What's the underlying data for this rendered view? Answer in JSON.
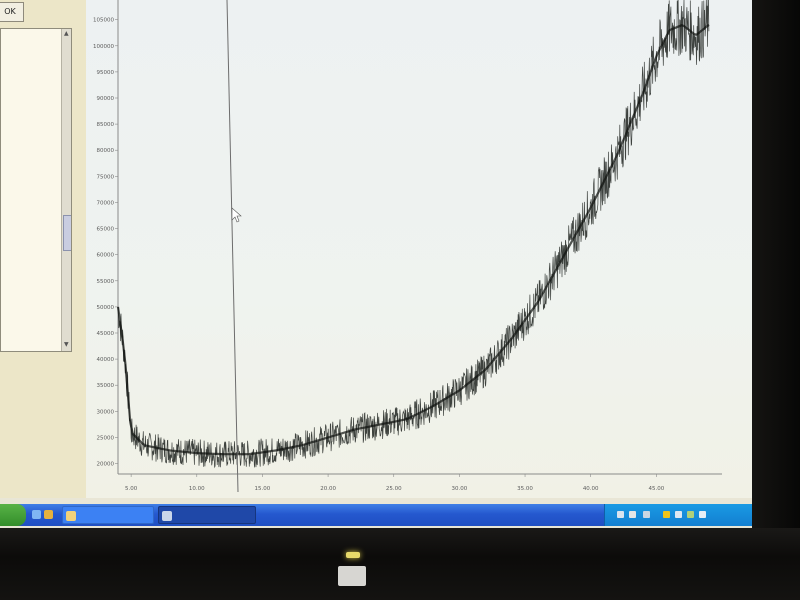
{
  "left_panel": {
    "ok_button_label": "OK",
    "list_items": [
      {
        "text": "",
        "selected": false
      },
      {
        "text": "",
        "selected": false
      },
      {
        "text": "",
        "selected": false
      },
      {
        "text": "",
        "selected": false
      },
      {
        "text": "",
        "selected": false
      },
      {
        "text": "",
        "selected": false
      },
      {
        "text": "",
        "selected": false
      },
      {
        "text": "",
        "selected": false
      },
      {
        "text": "",
        "selected": false
      },
      {
        "text": "",
        "selected": false
      },
      {
        "text": "",
        "selected": false
      },
      {
        "text": "",
        "selected": false
      },
      {
        "text": "",
        "selected": false
      },
      {
        "text": "",
        "selected": false
      },
      {
        "text": "",
        "selected": false
      },
      {
        "text": "",
        "selected": false
      },
      {
        "text": "",
        "selected": false
      },
      {
        "text": "",
        "selected": false
      },
      {
        "text": "",
        "selected": false
      },
      {
        "text": "",
        "selected": false
      },
      {
        "text": "",
        "selected": false
      },
      {
        "text": "",
        "selected": false
      },
      {
        "text": "",
        "selected": false
      },
      {
        "text": "",
        "selected": false
      },
      {
        "text": "",
        "selected": false
      },
      {
        "text": "",
        "selected": true
      }
    ]
  },
  "chart": {
    "x_unit_label": "",
    "x_ticks": [
      "5.00",
      "10.00",
      "15.00",
      "20.00",
      "25.00",
      "30.00",
      "35.00",
      "40.00",
      "45.00"
    ],
    "y_ticks": [
      "20000",
      "25000",
      "30000",
      "35000",
      "40000",
      "45000",
      "50000",
      "55000",
      "60000",
      "65000",
      "70000",
      "75000",
      "80000",
      "85000",
      "90000",
      "95000",
      "100000",
      "105000"
    ],
    "line_color": "#1f2320"
  },
  "chart_data": {
    "type": "line",
    "title": "",
    "xlabel": "",
    "ylabel": "",
    "xlim": [
      4.0,
      50.0
    ],
    "ylim": [
      18000,
      108000
    ],
    "grid": false,
    "series": [
      {
        "x": [
          4.0,
          4.5,
          5.0,
          6.0,
          8.0,
          10.0,
          12.0,
          14.0,
          16.0,
          18.0,
          20.0,
          22.0,
          24.0,
          26.0,
          28.0,
          30.0,
          32.0,
          34.0,
          36.0,
          38.0,
          40.0,
          42.0,
          44.0,
          45.0,
          46.0,
          47.0,
          48.0,
          49.0
        ],
        "y": [
          50000,
          41000,
          26000,
          23500,
          22500,
          22000,
          21800,
          21800,
          22500,
          23500,
          25000,
          26500,
          27500,
          28500,
          31000,
          34000,
          38000,
          44000,
          51000,
          60000,
          69000,
          79000,
          91000,
          98000,
          103000,
          104000,
          102000,
          104000
        ]
      }
    ]
  },
  "taskbar": {
    "start_label": "",
    "task_items": [
      {
        "label": "",
        "active": false
      },
      {
        "label": "",
        "active": true
      }
    ],
    "clock": ""
  }
}
